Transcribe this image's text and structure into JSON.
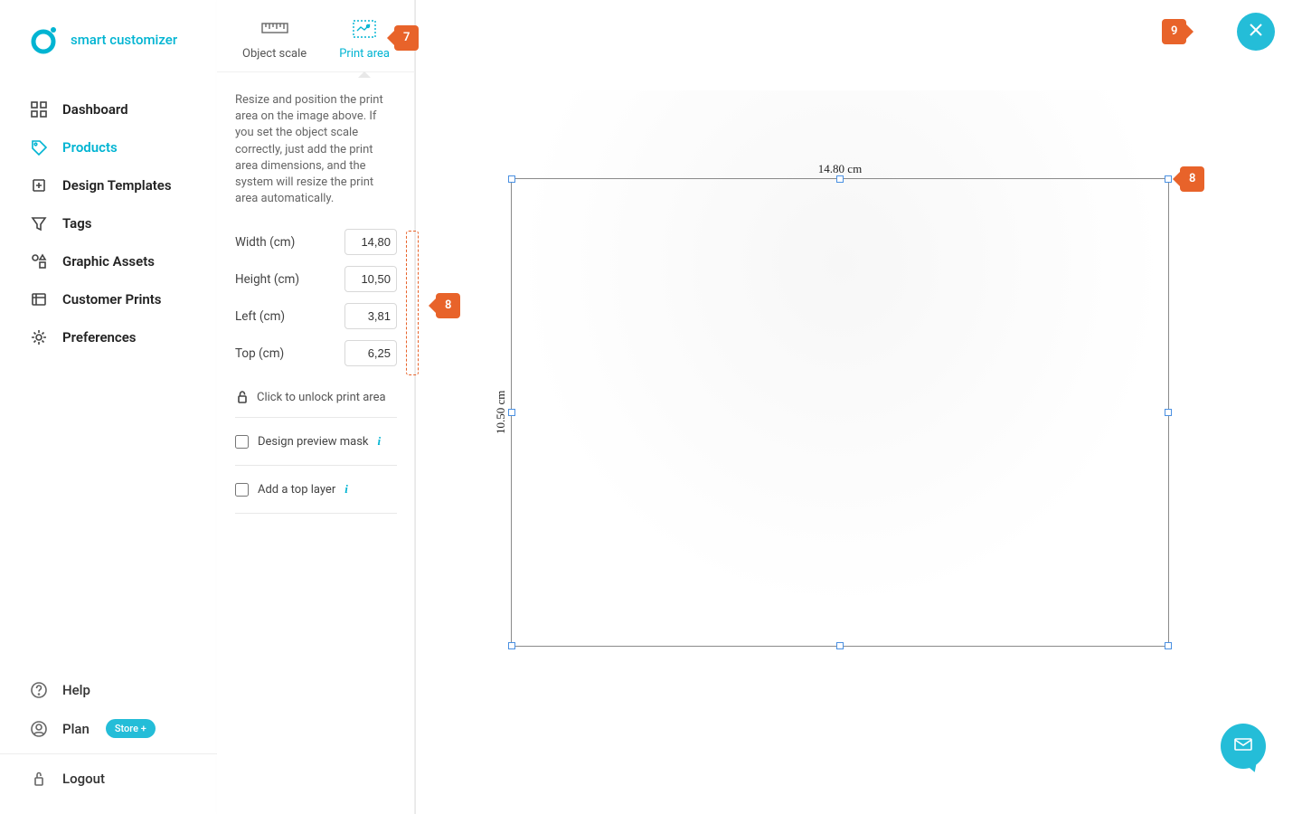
{
  "brand": {
    "name": "smart customizer"
  },
  "sidebar": {
    "items": [
      {
        "label": "Dashboard",
        "icon": "dashboard"
      },
      {
        "label": "Products",
        "icon": "tag",
        "active": true
      },
      {
        "label": "Design Templates",
        "icon": "templates"
      },
      {
        "label": "Tags",
        "icon": "funnel"
      },
      {
        "label": "Graphic Assets",
        "icon": "assets"
      },
      {
        "label": "Customer Prints",
        "icon": "prints"
      },
      {
        "label": "Preferences",
        "icon": "gear"
      }
    ],
    "footer": {
      "help": "Help",
      "plan": "Plan",
      "plan_badge": "Store +",
      "logout": "Logout"
    }
  },
  "tabs": {
    "object_scale": "Object scale",
    "print_area": "Print area"
  },
  "panel": {
    "desc": "Resize and position the print area on the image above. If you set the object scale correctly, just add the print area dimensions, and the system will resize the print area automatically.",
    "width_label": "Width (cm)",
    "width_value": "14,80",
    "height_label": "Height (cm)",
    "height_value": "10,50",
    "left_label": "Left (cm)",
    "left_value": "3,81",
    "top_label": "Top (cm)",
    "top_value": "6,25",
    "lock_label": "Click to unlock print area",
    "mask_label": "Design preview mask",
    "layer_label": "Add a top layer"
  },
  "canvas": {
    "dim_top": "14.80 cm",
    "dim_left": "10.50 cm"
  },
  "hints": {
    "h7": "7",
    "h8a": "8",
    "h8b": "8",
    "h9": "9"
  }
}
